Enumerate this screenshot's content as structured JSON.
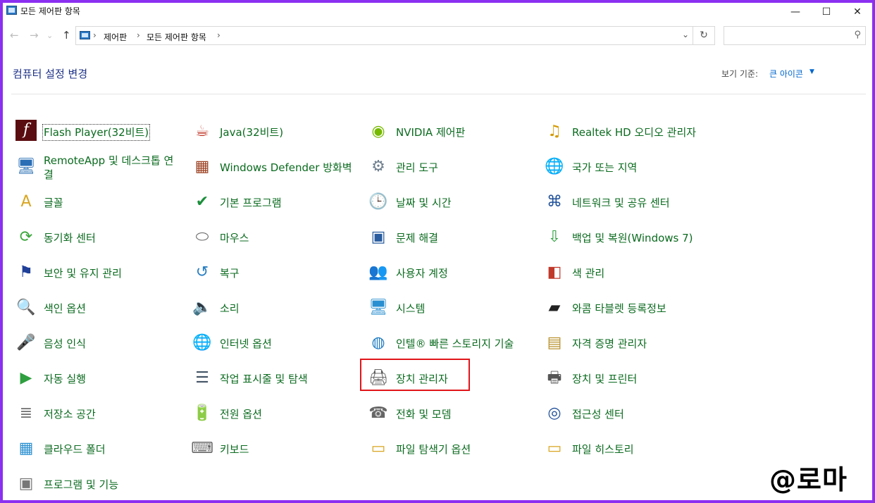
{
  "window": {
    "title": "모든 제어판 항목",
    "controls": {
      "minimize": "—",
      "maximize": "☐",
      "close": "✕"
    }
  },
  "nav": {
    "back": "←",
    "forward": "→",
    "recent": "⌄",
    "up": "↑"
  },
  "address": {
    "crumbs": [
      "제어판",
      "모든 제어판 항목"
    ],
    "separator": "›",
    "dropdown": "⌄",
    "refresh": "↻"
  },
  "search": {
    "placeholder": "",
    "icon": "search-icon"
  },
  "header": {
    "heading": "컴퓨터 설정 변경",
    "view_label": "보기 기준:",
    "view_value": "큰 아이콘",
    "view_caret": "▼"
  },
  "items": [
    {
      "label": "Flash Player(32비트)",
      "icon": "flash-player-icon",
      "glyph": "f",
      "color": "#5a0d10"
    },
    {
      "label": "Java(32비트)",
      "icon": "java-icon",
      "glyph": "☕",
      "color": "#c0392b"
    },
    {
      "label": "NVIDIA 제어판",
      "icon": "nvidia-icon",
      "glyph": "◉",
      "color": "#76b900"
    },
    {
      "label": "Realtek HD 오디오 관리자",
      "icon": "realtek-audio-icon",
      "glyph": "♫",
      "color": "#d49a00"
    },
    {
      "label": "RemoteApp 및 데스크톱 연결",
      "icon": "remoteapp-icon",
      "glyph": "🖥",
      "color": "#2a6fb5"
    },
    {
      "label": "Windows Defender 방화벽",
      "icon": "firewall-icon",
      "glyph": "▦",
      "color": "#9a3f1f"
    },
    {
      "label": "관리 도구",
      "icon": "admin-tools-icon",
      "glyph": "⚙",
      "color": "#6f7f8f"
    },
    {
      "label": "국가 또는 지역",
      "icon": "region-icon",
      "glyph": "🌐",
      "color": "#1f7bc1"
    },
    {
      "label": "글꼴",
      "icon": "fonts-icon",
      "glyph": "A",
      "color": "#d9a521"
    },
    {
      "label": "기본 프로그램",
      "icon": "default-programs-icon",
      "glyph": "✔",
      "color": "#1c8f3c"
    },
    {
      "label": "날짜 및 시간",
      "icon": "date-time-icon",
      "glyph": "🕒",
      "color": "#2d6fb0"
    },
    {
      "label": "네트워크 및 공유 센터",
      "icon": "network-icon",
      "glyph": "⌘",
      "color": "#1e4f99"
    },
    {
      "label": "동기화 센터",
      "icon": "sync-center-icon",
      "glyph": "⟳",
      "color": "#3aa53a"
    },
    {
      "label": "마우스",
      "icon": "mouse-icon",
      "glyph": "⬭",
      "color": "#666666"
    },
    {
      "label": "문제 해결",
      "icon": "troubleshoot-icon",
      "glyph": "▣",
      "color": "#2a5d9f"
    },
    {
      "label": "백업 및 복원(Windows 7)",
      "icon": "backup-icon",
      "glyph": "⇩",
      "color": "#2f9f3f"
    },
    {
      "label": "보안 및 유지 관리",
      "icon": "security-flag-icon",
      "glyph": "⚑",
      "color": "#1f3f99"
    },
    {
      "label": "복구",
      "icon": "recovery-icon",
      "glyph": "↺",
      "color": "#2a7fc2"
    },
    {
      "label": "사용자 계정",
      "icon": "user-accounts-icon",
      "glyph": "👥",
      "color": "#3a7fc0"
    },
    {
      "label": "색 관리",
      "icon": "color-management-icon",
      "glyph": "◧",
      "color": "#c0392b"
    },
    {
      "label": "색인 옵션",
      "icon": "indexing-icon",
      "glyph": "🔍",
      "color": "#777777"
    },
    {
      "label": "소리",
      "icon": "sound-icon",
      "glyph": "🔈",
      "color": "#555555"
    },
    {
      "label": "시스템",
      "icon": "system-icon",
      "glyph": "🖥",
      "color": "#2a8fd0"
    },
    {
      "label": "와콤 타블렛 등록정보",
      "icon": "wacom-tablet-icon",
      "glyph": "▰",
      "color": "#222222"
    },
    {
      "label": "음성 인식",
      "icon": "speech-icon",
      "glyph": "🎤",
      "color": "#666666"
    },
    {
      "label": "인터넷 옵션",
      "icon": "internet-options-icon",
      "glyph": "🌐",
      "color": "#1f7bc1"
    },
    {
      "label": "인텔® 빠른 스토리지 기술",
      "icon": "intel-storage-icon",
      "glyph": "◍",
      "color": "#1f7bc1"
    },
    {
      "label": "자격 증명 관리자",
      "icon": "credential-manager-icon",
      "glyph": "▤",
      "color": "#b8912f"
    },
    {
      "label": "자동 실행",
      "icon": "autoplay-icon",
      "glyph": "▶",
      "color": "#2f9f3f"
    },
    {
      "label": "작업 표시줄 및 탐색",
      "icon": "taskbar-icon",
      "glyph": "☰",
      "color": "#445566"
    },
    {
      "label": "장치 관리자",
      "icon": "device-manager-icon",
      "glyph": "🖨",
      "color": "#555555"
    },
    {
      "label": "장치 및 프린터",
      "icon": "devices-printers-icon",
      "glyph": "🖶",
      "color": "#555555"
    },
    {
      "label": "저장소 공간",
      "icon": "storage-spaces-icon",
      "glyph": "≣",
      "color": "#777777"
    },
    {
      "label": "전원 옵션",
      "icon": "power-options-icon",
      "glyph": "🔋",
      "color": "#3aa53a"
    },
    {
      "label": "전화 및 모뎀",
      "icon": "phone-modem-icon",
      "glyph": "☎",
      "color": "#666666"
    },
    {
      "label": "접근성 센터",
      "icon": "ease-of-access-icon",
      "glyph": "◎",
      "color": "#1f4f99"
    },
    {
      "label": "클라우드 폴더",
      "icon": "cloud-folder-icon",
      "glyph": "▦",
      "color": "#2a8fd0"
    },
    {
      "label": "키보드",
      "icon": "keyboard-icon",
      "glyph": "⌨",
      "color": "#666666"
    },
    {
      "label": "파일 탐색기 옵션",
      "icon": "file-explorer-options-icon",
      "glyph": "▭",
      "color": "#d9a521"
    },
    {
      "label": "파일 히스토리",
      "icon": "file-history-icon",
      "glyph": "▭",
      "color": "#d9a521"
    },
    {
      "label": "프로그램 및 기능",
      "icon": "programs-features-icon",
      "glyph": "▣",
      "color": "#777777"
    }
  ],
  "watermark": "@로마"
}
